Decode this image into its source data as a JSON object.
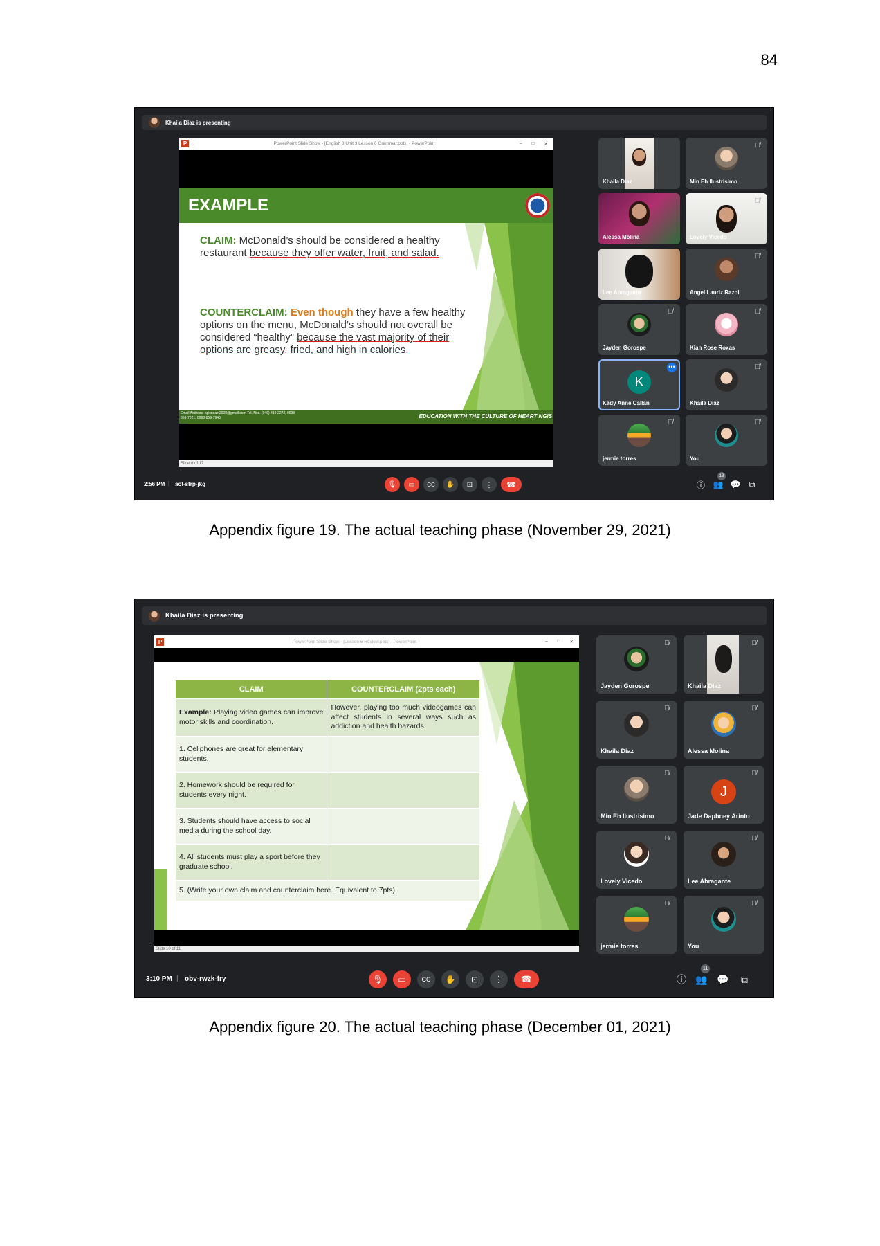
{
  "page_number": "84",
  "figure19": {
    "caption": "Appendix figure 19. The actual teaching phase (November 29, 2021)",
    "presenting": "Khaila Diaz is presenting",
    "ppt_title": "PowerPoint Slide Show - [English 8 Unit 3 Lesson 6 Grammar.pptx] - PowerPoint",
    "slide_status": "Slide 6 of 17",
    "slide": {
      "title": "EXAMPLE",
      "claim_label": "CLAIM:",
      "claim_plain": "McDonald’s should be considered a healthy restaurant",
      "claim_underlined": "because they offer water, fruit, and salad.",
      "counter_label": "COUNTERCLAIM:",
      "counter_emph": "Even though",
      "counter_plain": "they have a few healthy options on the menu, McDonald’s should not overall be considered “healthy”",
      "counter_underlined": "because the vast majority of their options are greasy, fried, and high in calories.",
      "footer_contact": "Email Address: ngisnsain2008@gmail.com Tel. Nos. (046) 419-2272, 0998-859-7821, 0998-859-7940",
      "footer_motto": "EDUCATION WITH THE CULTURE OF HEART NGIS"
    },
    "participants": [
      "Khaila Diaz",
      "Min Eh Ilustrisimo",
      "Alessa Molina",
      "Lovely Vicedo",
      "Lee Abragante",
      "Angel Lauriz Razol",
      "Jayden Gorospe",
      "Kian Rose Roxas",
      "Kady Anne Callan",
      "Khaila Diaz",
      "jermie torres",
      "You"
    ],
    "kady_letter": "K",
    "time": "2:56 PM",
    "meeting_code": "aot-strp-jkg",
    "people_count": "13"
  },
  "figure20": {
    "caption": "Appendix figure 20. The actual teaching phase (December 01, 2021)",
    "presenting": "Khaila Diaz is presenting",
    "ppt_title": "PowerPoint Slide Show - [Lesson 6 Review.pptx] - PowerPoint",
    "slide_status": "Slide 10 of 11",
    "table": {
      "headers": [
        "CLAIM",
        "COUNTERCLAIM (2pts each)"
      ],
      "example_label": "Example:",
      "example_claim": "Playing video games can improve motor skills and coordination.",
      "example_counter": "However, playing too much videogames can affect students in several ways such as addiction and health hazards.",
      "items": [
        "1.  Cellphones are great for elementary students.",
        "2.  Homework should be required for students every night.",
        "3.  Students should have access to social media during the school day.",
        "4.  All students must play a sport before they graduate school.",
        "5.  (Write your own claim and counterclaim here. Equivalent to 7pts)"
      ]
    },
    "participants": [
      "Jayden Gorospe",
      "Khaila Diaz",
      "Khaila Diaz",
      "Alessa Molina",
      "Min Eh Ilustrisimo",
      "Jade Daphney Arinto",
      "Lovely Vicedo",
      "Lee Abragante",
      "jermie torres",
      "You"
    ],
    "jade_letter": "J",
    "time": "3:10 PM",
    "meeting_code": "obv-rwzk-fry",
    "people_count": "11"
  },
  "icons": [
    "mic-off-icon",
    "camera-off-icon",
    "captions-icon",
    "raise-hand-icon",
    "present-icon",
    "more-options-icon",
    "end-call-icon",
    "info-icon",
    "people-icon",
    "chat-icon",
    "activities-icon"
  ],
  "colors": {
    "meet_bg": "#202124",
    "tile_bg": "#3c4043",
    "danger_red": "#ea4335",
    "slide_green": "#4a8a2a",
    "accent_orange": "#e07b1a"
  }
}
